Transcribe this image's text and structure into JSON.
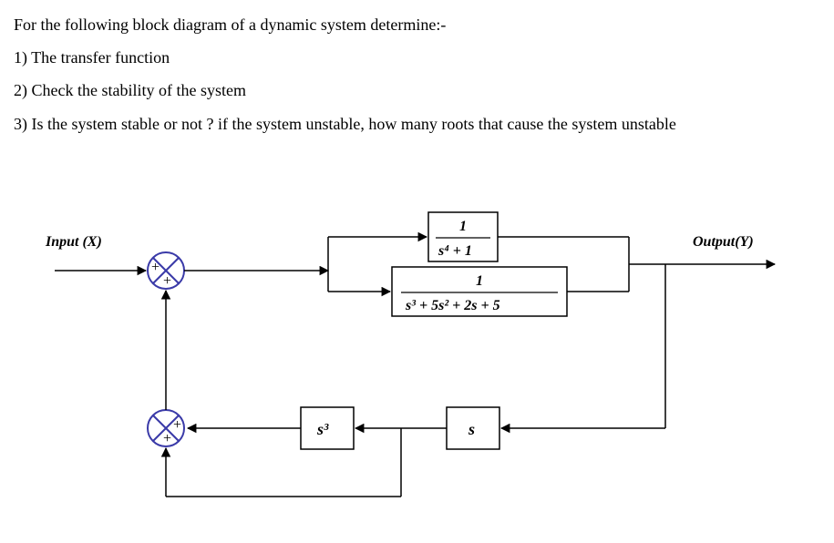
{
  "problem": {
    "heading": "For the following block diagram of a dynamic system determine:-",
    "q1": "1)  The transfer function",
    "q2": "2)  Check the stability of the system",
    "q3": "3)   Is the system stable or not ? if  the system unstable, how many roots that cause the system unstable"
  },
  "diagram": {
    "input_label": "Input (X)",
    "output_label": "Output(Y)",
    "block_top_num": "1",
    "block_top_den": "s⁴ + 1",
    "block_bottom_num": "1",
    "block_bottom_den": "s³ + 5s² + 2s + 5",
    "fb_block_s": "s",
    "fb_block_s3": "s³",
    "sum1_plus_top": "+",
    "sum1_plus_bottom": "+",
    "sum2_plus_right": "+",
    "sum2_plus_bottom": "+"
  },
  "chart_data": {
    "type": "block_diagram",
    "description": "Control-system block diagram with positive feedback",
    "nodes": [
      {
        "id": "input",
        "label": "Input (X)"
      },
      {
        "id": "sum1",
        "type": "summing_junction",
        "signs": [
          "+",
          "+"
        ]
      },
      {
        "id": "branch",
        "type": "branch_point"
      },
      {
        "id": "G1",
        "type": "transfer_block",
        "expr": "1/(s^4 + 1)"
      },
      {
        "id": "G2",
        "type": "transfer_block",
        "expr": "1/(s^3 + 5s^2 + 2s + 5)"
      },
      {
        "id": "output",
        "label": "Output(Y)"
      },
      {
        "id": "H1",
        "type": "transfer_block",
        "expr": "s"
      },
      {
        "id": "H2",
        "type": "transfer_block",
        "expr": "s^3"
      },
      {
        "id": "sum2",
        "type": "summing_junction",
        "signs": [
          "+",
          "+"
        ]
      }
    ],
    "edges": [
      {
        "from": "input",
        "to": "sum1"
      },
      {
        "from": "sum1",
        "to": "branch"
      },
      {
        "from": "branch",
        "to": "G1"
      },
      {
        "from": "branch",
        "to": "G2"
      },
      {
        "from": "G1",
        "to": "output",
        "note": "parallel sum with G2 implied at output node"
      },
      {
        "from": "G2",
        "to": "output"
      },
      {
        "from": "output",
        "to": "H1"
      },
      {
        "from": "H1",
        "to": "sum2"
      },
      {
        "from": "branch",
        "to": "sum2",
        "note": "lower loop directly from pre-parallel branch"
      },
      {
        "from": "sum2",
        "to": "H2"
      },
      {
        "from": "H2",
        "to": "sum2",
        "note": "via second + input (interpretation)"
      },
      {
        "from": "sum2",
        "to": "sum1",
        "sign": "+"
      }
    ]
  }
}
